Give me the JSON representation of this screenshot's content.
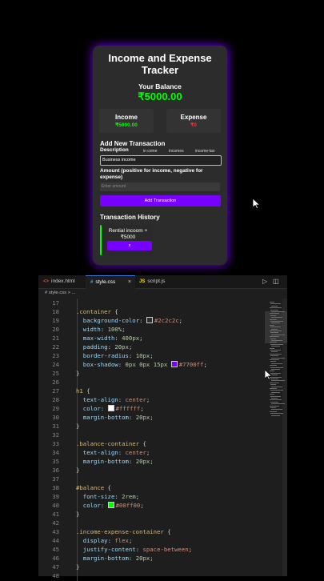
{
  "app": {
    "title": "Income and Expense Tracker",
    "balance_label": "Your Balance",
    "balance_value": "₹5000.00",
    "income_label": "Income",
    "income_value": "₹5000.00",
    "expense_label": "Expense",
    "expense_value": "₹0",
    "add_section_title": "Add New Transaction",
    "description_label": "Description",
    "suggestions": [
      "in come",
      "incomes",
      "income-tax"
    ],
    "description_value": "Business income",
    "amount_label": "Amount (positive for income, negative for expense)",
    "amount_placeholder": "Enter amount",
    "add_button": "Add Transaction",
    "history_title": "Transaction History",
    "transactions": [
      {
        "text": "Rential incoom + ₹5000",
        "delete_label": "x"
      }
    ]
  },
  "editor": {
    "tabs": [
      {
        "name": "index.html",
        "icon": "<>",
        "icon_color": "#e44d26"
      },
      {
        "name": "style.css",
        "icon": "#",
        "icon_color": "#42a5f5"
      },
      {
        "name": "script.js",
        "icon": "JS",
        "icon_color": "#f5de19"
      }
    ],
    "active_tab": "style.css",
    "breadcrumb": "# style.css > ...",
    "tab_close": "×",
    "run_icon": "▷",
    "split_icon": "◫",
    "lines": [
      {
        "n": "17",
        "t": ""
      },
      {
        "n": "18",
        "t": ".container {"
      },
      {
        "n": "19",
        "t": "  background-color: #2c2c2c;"
      },
      {
        "n": "20",
        "t": "  width: 100%;"
      },
      {
        "n": "21",
        "t": "  max-width: 400px;"
      },
      {
        "n": "22",
        "t": "  padding: 20px;"
      },
      {
        "n": "23",
        "t": "  border-radius: 10px;"
      },
      {
        "n": "24",
        "t": "  box-shadow: 0px 0px 15px #7700ff;"
      },
      {
        "n": "25",
        "t": "}"
      },
      {
        "n": "26",
        "t": ""
      },
      {
        "n": "27",
        "t": "h1 {"
      },
      {
        "n": "28",
        "t": "  text-align: center;"
      },
      {
        "n": "29",
        "t": "  color: #ffffff;"
      },
      {
        "n": "30",
        "t": "  margin-bottom: 20px;"
      },
      {
        "n": "31",
        "t": "}"
      },
      {
        "n": "32",
        "t": ""
      },
      {
        "n": "33",
        "t": ".balance-container {"
      },
      {
        "n": "34",
        "t": "  text-align: center;"
      },
      {
        "n": "35",
        "t": "  margin-bottom: 20px;"
      },
      {
        "n": "36",
        "t": "}"
      },
      {
        "n": "37",
        "t": ""
      },
      {
        "n": "38",
        "t": "#balance {"
      },
      {
        "n": "39",
        "t": "  font-size: 2rem;"
      },
      {
        "n": "40",
        "t": "  color: #00ff00;"
      },
      {
        "n": "41",
        "t": "}"
      },
      {
        "n": "42",
        "t": ""
      },
      {
        "n": "43",
        "t": ".income-expense-container {"
      },
      {
        "n": "44",
        "t": "  display: flex;"
      },
      {
        "n": "45",
        "t": "  justify-content: space-between;"
      },
      {
        "n": "46",
        "t": "  margin-bottom: 20px;"
      },
      {
        "n": "47",
        "t": "}"
      },
      {
        "n": "48",
        "t": ""
      }
    ]
  },
  "colors": {
    "accent": "#7700ff",
    "positive": "#00ff00",
    "negative": "#ff3333",
    "card_bg": "#2c2c2c"
  }
}
